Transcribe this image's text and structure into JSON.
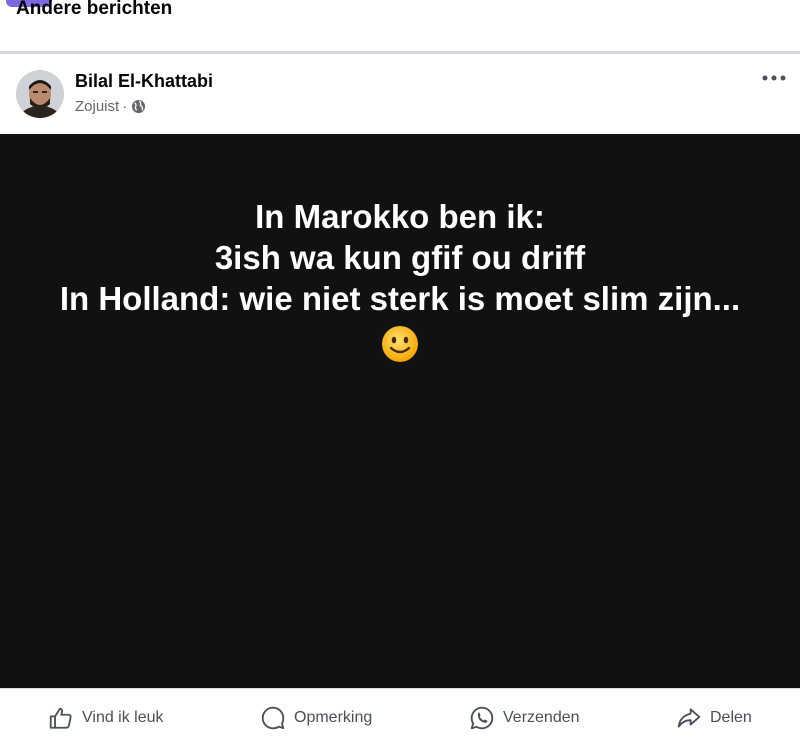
{
  "feed": {
    "section_title": "Andere berichten"
  },
  "post": {
    "author": "Bilal El-Khattabi",
    "time": "Zojuist",
    "separator": "·",
    "privacy_icon": "globe-icon",
    "more_icon": "more-options-icon",
    "text_lines": [
      "In Marokko ben ik:",
      "3ish wa kun gfif ou driff",
      "In Holland: wie niet sterk is moet slim zijn..."
    ],
    "emoji": "smiley-icon"
  },
  "actions": {
    "like_label": "Vind ik leuk",
    "comment_label": "Opmerking",
    "send_label": "Verzenden",
    "share_label": "Delen"
  },
  "colors": {
    "image_background": "#111111",
    "secondary_text": "#65676b",
    "action_text": "#4b4f56",
    "badge": "#7b6ae0"
  }
}
